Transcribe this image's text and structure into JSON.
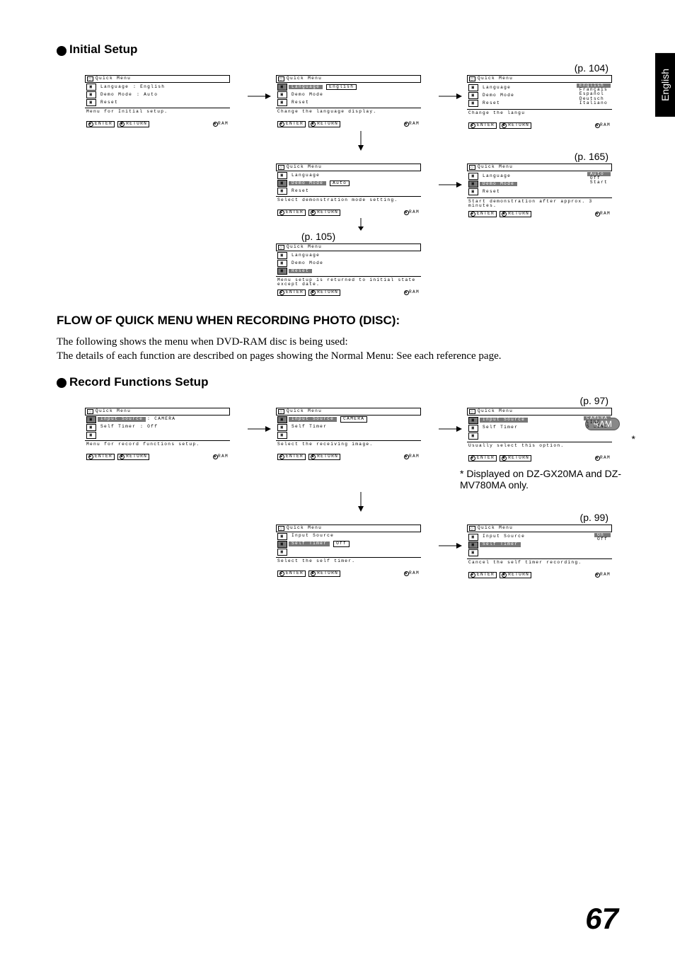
{
  "side_tab": "English",
  "page_number": "67",
  "sections": {
    "initial_setup": {
      "heading": "Initial Setup",
      "p104": "(p. 104)",
      "p165": "(p. 165)",
      "p105": "(p. 105)",
      "menus": {
        "m1": {
          "title": "Quick Menu",
          "items": [
            {
              "label": "Language",
              "value": ": English"
            },
            {
              "label": "Demo Mode",
              "value": ": Auto"
            },
            {
              "label": "Reset",
              "value": ""
            }
          ],
          "desc": "Menu for Initial setup.",
          "enter": "ENTER",
          "return": "RETURN",
          "badge": "RAM"
        },
        "m2": {
          "title": "Quick Menu",
          "items": [
            {
              "label": "Language",
              "value": "English",
              "boxed": true,
              "hl": true
            },
            {
              "label": "Demo Mode",
              "value": ""
            },
            {
              "label": "Reset",
              "value": ""
            }
          ],
          "desc": "Change the language display.",
          "enter": "ENTER",
          "return": "RETURN",
          "badge": "RAM"
        },
        "m3": {
          "title": "Quick Menu",
          "items_left": [
            {
              "label": "Language"
            },
            {
              "label": "Demo Mode"
            },
            {
              "label": "Reset"
            }
          ],
          "lang_options": [
            "English",
            "Français",
            "Español",
            "Deutsch",
            "Italiano"
          ],
          "desc": "Change the langu",
          "enter": "ENTER",
          "return": "RETURN",
          "badge": "RAM"
        },
        "m4": {
          "title": "Quick Menu",
          "items": [
            {
              "label": "Language",
              "value": ""
            },
            {
              "label": "Demo Mode",
              "value": "Auto",
              "boxed": true,
              "hl": true
            },
            {
              "label": "Reset",
              "value": ""
            }
          ],
          "desc": "Select demonstration mode setting.",
          "enter": "ENTER",
          "return": "RETURN",
          "badge": "RAM"
        },
        "m5": {
          "title": "Quick Menu",
          "items_left": [
            {
              "label": "Language"
            },
            {
              "label": "Demo Mode",
              "hl": true
            },
            {
              "label": "Reset"
            }
          ],
          "lang_options": [
            "Auto",
            "Off",
            "Start"
          ],
          "desc": "Start demonstration after approx. 3 minutes.",
          "enter": "ENTER",
          "return": "RETURN",
          "badge": "RAM"
        },
        "m6": {
          "title": "Quick Menu",
          "items": [
            {
              "label": "Language",
              "value": ""
            },
            {
              "label": "Demo Mode",
              "value": ""
            },
            {
              "label": "Reset",
              "value": "",
              "hl": true
            }
          ],
          "desc": "Menu setup is returned to initial state except date.",
          "enter": "ENTER",
          "return": "RETURN",
          "badge": "RAM"
        }
      }
    },
    "flow_heading": "FLOW OF QUICK MENU WHEN RECORDING PHOTO (DISC):",
    "flow_body": "The following shows the menu when DVD-RAM disc is being used:\nThe details of each function are described on pages showing the Normal Menu: See each reference page.",
    "ram_badge": "RAM",
    "record_setup": {
      "heading": "Record Functions Setup",
      "p97": "(p. 97)",
      "p99": "(p. 99)",
      "footnote": "* Displayed on DZ-GX20MA and DZ-MV780MA only.",
      "menus": {
        "r1": {
          "title": "Quick Menu",
          "items": [
            {
              "label": "Input Source",
              "value": ": CAMERA",
              "hl": true
            },
            {
              "label": "Self Timer",
              "value": ": Off"
            }
          ],
          "desc": "Menu for record functions setup.",
          "enter": "ENTER",
          "return": "RETURN",
          "badge": "RAM"
        },
        "r2": {
          "title": "Quick Menu",
          "items": [
            {
              "label": "Input Source",
              "value": "CAMERA",
              "boxed": true,
              "hl": true
            },
            {
              "label": "Self Timer",
              "value": ""
            }
          ],
          "desc": "Select the receiving image.",
          "enter": "ENTER",
          "return": "RETURN",
          "badge": "RAM"
        },
        "r3": {
          "title": "Quick Menu",
          "items_left": [
            {
              "label": "Input Source",
              "hl": true
            },
            {
              "label": "Self Timer"
            }
          ],
          "lang_options": [
            "CAMERA",
            "LINE",
            "S LINE"
          ],
          "desc": "Usually select this option.",
          "enter": "ENTER",
          "return": "RETURN",
          "badge": "RAM"
        },
        "r4": {
          "title": "Quick Menu",
          "items": [
            {
              "label": "Input Source",
              "value": ""
            },
            {
              "label": "Self Timer",
              "value": "Off",
              "boxed": true,
              "hl": true
            }
          ],
          "desc": "Select the self timer.",
          "enter": "ENTER",
          "return": "RETURN",
          "badge": "RAM"
        },
        "r5": {
          "title": "Quick Menu",
          "items_left": [
            {
              "label": "Input Source"
            },
            {
              "label": "Self Timer",
              "hl": true
            }
          ],
          "lang_options": [
            "On",
            "Off"
          ],
          "desc": "Cancel the self timer recording.",
          "enter": "ENTER",
          "return": "RETURN",
          "badge": "RAM"
        }
      }
    }
  }
}
